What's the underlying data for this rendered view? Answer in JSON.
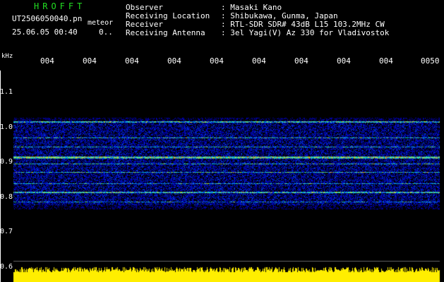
{
  "header": {
    "brand": "HROFFT",
    "filename": "UT2506050040.pn",
    "meteor_tag": "meteor",
    "timestamp": "25.06.05 00:40",
    "extra": "0.."
  },
  "info": [
    {
      "label": "Observer",
      "value": ": Masaki Kano"
    },
    {
      "label": "Receiving Location",
      "value": ": Shibukawa, Gunma, Japan"
    },
    {
      "label": "Receiver",
      "value": ": RTL-SDR SDR# 43dB L15 103.2MHz CW"
    },
    {
      "label": "Receiving Antenna",
      "value": ": 3el Yagi(V) Az 330 for Vladivostok"
    }
  ],
  "axis": {
    "unit": "kHz",
    "x_ticks": [
      "004",
      "004",
      "004",
      "004",
      "004",
      "004",
      "004",
      "004",
      "004",
      "0050"
    ],
    "y_ticks": [
      "1.1",
      "1.0",
      "0.9",
      "0.8",
      "0.7",
      "0.6"
    ]
  },
  "colors": {
    "background": "#000000",
    "brand": "#22dd22",
    "axis": "#ffffff",
    "baseline": "#ffee00"
  }
}
